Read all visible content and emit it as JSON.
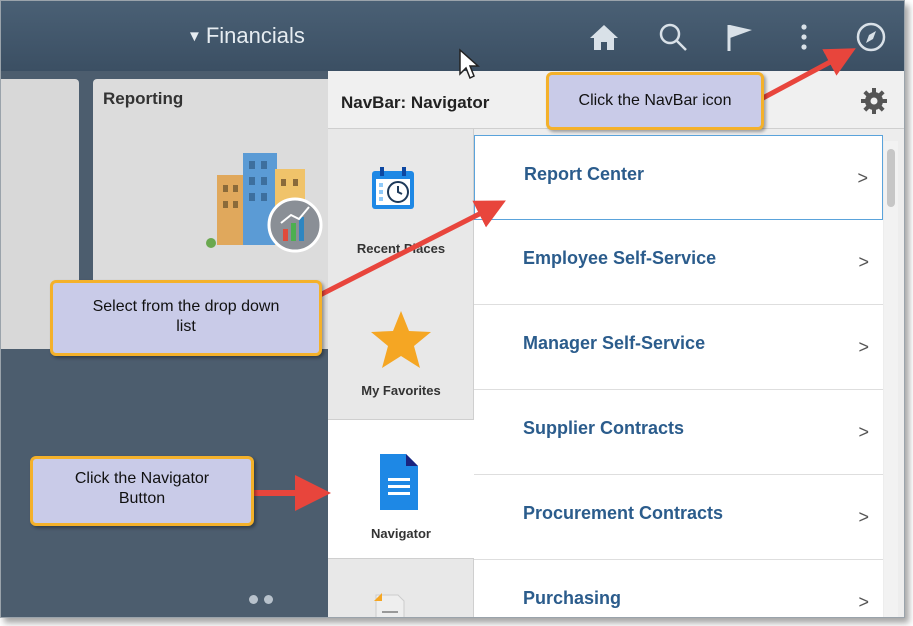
{
  "header": {
    "title": "Financials"
  },
  "tiles": {
    "reporting_title": "Reporting"
  },
  "navbar": {
    "title": "NavBar: Navigator",
    "buttons": [
      {
        "label": "Recent Places"
      },
      {
        "label": "My Favorites"
      },
      {
        "label": "Navigator"
      }
    ],
    "items": [
      {
        "label": "Report Center"
      },
      {
        "label": "Employee Self-Service"
      },
      {
        "label": "Manager Self-Service"
      },
      {
        "label": "Supplier Contracts"
      },
      {
        "label": "Procurement Contracts"
      },
      {
        "label": "Purchasing"
      }
    ]
  },
  "callouts": {
    "navbar_icon": "Click the NavBar icon",
    "dropdown": "Select from the drop down list",
    "navigator_button": "Click the Navigator Button"
  },
  "colors": {
    "accent": "#2b5c8c",
    "callout_bg": "#c9cbe8",
    "callout_border": "#f4b12a",
    "arrow": "#e8453c"
  }
}
